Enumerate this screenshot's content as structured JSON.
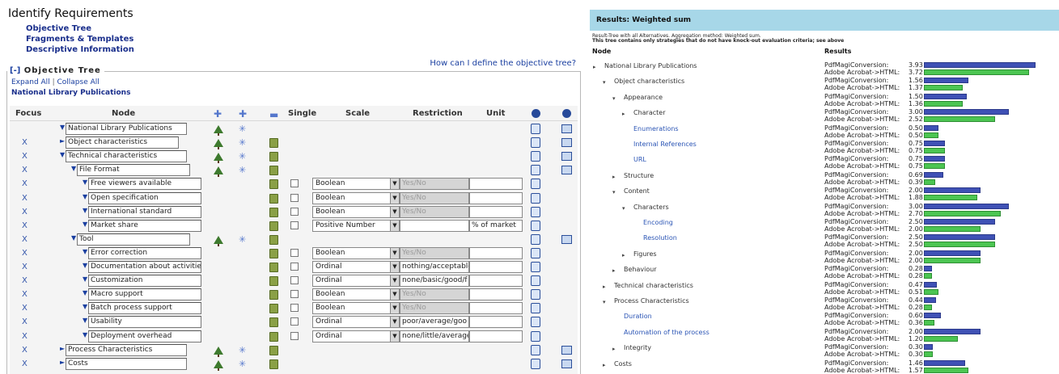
{
  "left": {
    "title": "Identify Requirements",
    "nav": [
      "Objective Tree",
      "Fragments & Templates",
      "Descriptive Information"
    ],
    "help_link": "How can I define the objective tree?",
    "legend_toggle": "[-]",
    "legend_title": "Objective Tree",
    "expand_all": "Expand All",
    "separator": "|",
    "collapse_all": "Collapse All",
    "breadcrumb": "National Library Publications",
    "headers": {
      "focus": "Focus",
      "node": "Node",
      "single": "Single",
      "scale": "Scale",
      "restriction": "Restriction",
      "unit": "Unit"
    },
    "rows": [
      {
        "x": "",
        "tri": "▼",
        "label": "National Library Publications",
        "indent": 62,
        "w": 150,
        "tree": true,
        "snow": true,
        "trash": false,
        "leaf": false,
        "i2": true
      },
      {
        "x": "X",
        "tri": "►",
        "label": "Object characteristics",
        "indent": 62,
        "w": 140,
        "tree": true,
        "snow": true,
        "trash": true,
        "leaf": false,
        "i2": true
      },
      {
        "x": "X",
        "tri": "▼",
        "label": "Technical characteristics",
        "indent": 62,
        "w": 150,
        "tree": true,
        "snow": true,
        "trash": true,
        "leaf": false,
        "i2": true
      },
      {
        "x": "X",
        "tri": "▼",
        "label": "File Format",
        "indent": 76,
        "w": 140,
        "tree": true,
        "snow": true,
        "trash": true,
        "leaf": false,
        "i2": true
      },
      {
        "x": "X",
        "tri": "▼",
        "label": "Free viewers available",
        "indent": 90,
        "w": 140,
        "trash": true,
        "leaf": true,
        "scale": "Boolean",
        "restriction": "Yes/No",
        "dis": true,
        "unit": ""
      },
      {
        "x": "X",
        "tri": "▼",
        "label": "Open specification",
        "indent": 90,
        "w": 140,
        "trash": true,
        "leaf": true,
        "scale": "Boolean",
        "restriction": "Yes/No",
        "dis": true,
        "unit": ""
      },
      {
        "x": "X",
        "tri": "▼",
        "label": "International standard",
        "indent": 90,
        "w": 140,
        "trash": true,
        "leaf": true,
        "scale": "Boolean",
        "restriction": "Yes/No",
        "dis": true,
        "unit": ""
      },
      {
        "x": "X",
        "tri": "▼",
        "label": "Market share",
        "indent": 90,
        "w": 140,
        "trash": true,
        "leaf": true,
        "scale": "Positive Number",
        "restriction": "",
        "dis": false,
        "unit": "% of market"
      },
      {
        "x": "X",
        "tri": "▼",
        "label": "Tool",
        "indent": 76,
        "w": 140,
        "tree": true,
        "snow": true,
        "trash": true,
        "leaf": false,
        "i2": true
      },
      {
        "x": "X",
        "tri": "▼",
        "label": "Error correction",
        "indent": 90,
        "w": 140,
        "trash": true,
        "leaf": true,
        "scale": "Boolean",
        "restriction": "Yes/No",
        "dis": true,
        "unit": ""
      },
      {
        "x": "X",
        "tri": "▼",
        "label": "Documentation about activities",
        "indent": 90,
        "w": 140,
        "trash": true,
        "leaf": true,
        "scale": "Ordinal",
        "restriction": "nothing/acceptable",
        "dis": false,
        "unit": ""
      },
      {
        "x": "X",
        "tri": "▼",
        "label": "Customization",
        "indent": 90,
        "w": 140,
        "trash": true,
        "leaf": true,
        "scale": "Ordinal",
        "restriction": "none/basic/good/f",
        "dis": false,
        "unit": ""
      },
      {
        "x": "X",
        "tri": "▼",
        "label": "Macro support",
        "indent": 90,
        "w": 140,
        "trash": true,
        "leaf": true,
        "scale": "Boolean",
        "restriction": "Yes/No",
        "dis": true,
        "unit": ""
      },
      {
        "x": "X",
        "tri": "▼",
        "label": "Batch process support",
        "indent": 90,
        "w": 140,
        "trash": true,
        "leaf": true,
        "scale": "Boolean",
        "restriction": "Yes/No",
        "dis": true,
        "unit": ""
      },
      {
        "x": "X",
        "tri": "▼",
        "label": "Usability",
        "indent": 90,
        "w": 140,
        "trash": true,
        "leaf": true,
        "scale": "Ordinal",
        "restriction": "poor/average/goo",
        "dis": false,
        "unit": ""
      },
      {
        "x": "X",
        "tri": "▼",
        "label": "Deployment overhead",
        "indent": 90,
        "w": 140,
        "trash": true,
        "leaf": true,
        "scale": "Ordinal",
        "restriction": "none/little/average",
        "dis": false,
        "unit": ""
      },
      {
        "x": "X",
        "tri": "►",
        "label": "Process Characteristics",
        "indent": 62,
        "w": 150,
        "tree": true,
        "snow": true,
        "trash": true,
        "leaf": false,
        "i2": true
      },
      {
        "x": "X",
        "tri": "►",
        "label": "Costs",
        "indent": 62,
        "w": 150,
        "tree": true,
        "snow": true,
        "trash": true,
        "leaf": false,
        "i2": true
      }
    ]
  },
  "right": {
    "header": "Results: Weighted sum",
    "info1": "Result-Tree with all Alternatives. Aggregation method: Weighted sum.",
    "info2": "This tree contains only strategies that do not have knock-out evaluation criteria; see above",
    "col_node": "Node",
    "col_results": "Results",
    "alt1": "PdfMagiConversion:",
    "alt2": "Adobe Acrobat->HTML:",
    "bar_max": 4,
    "color_alt1": "#3f51b5",
    "color_alt2": "#4cc552",
    "rows": [
      {
        "bul": "▸",
        "label": "National Library Publications",
        "indent": 4,
        "link": false,
        "v1": "3.93",
        "v2": "3.72"
      },
      {
        "bul": "▾",
        "label": "Object characteristics",
        "indent": 16,
        "link": false,
        "v1": "1.56",
        "v2": "1.37"
      },
      {
        "bul": "▾",
        "label": "Appearance",
        "indent": 28,
        "link": false,
        "v1": "1.50",
        "v2": "1.36"
      },
      {
        "bul": "▸",
        "label": "Character",
        "indent": 40,
        "link": false,
        "v1": "3.00",
        "v2": "2.52"
      },
      {
        "bul": "",
        "label": "Enumerations",
        "indent": 40,
        "link": true,
        "v1": "0.50",
        "v2": "0.50"
      },
      {
        "bul": "",
        "label": "Internal References",
        "indent": 40,
        "link": true,
        "v1": "0.75",
        "v2": "0.75"
      },
      {
        "bul": "",
        "label": "URL",
        "indent": 40,
        "link": true,
        "v1": "0.75",
        "v2": "0.75"
      },
      {
        "bul": "▸",
        "label": "Structure",
        "indent": 28,
        "link": false,
        "v1": "0.69",
        "v2": "0.39"
      },
      {
        "bul": "▾",
        "label": "Content",
        "indent": 28,
        "link": false,
        "v1": "2.00",
        "v2": "1.88"
      },
      {
        "bul": "▾",
        "label": "Characters",
        "indent": 40,
        "link": false,
        "v1": "3.00",
        "v2": "2.70"
      },
      {
        "bul": "",
        "label": "Encoding",
        "indent": 52,
        "link": true,
        "v1": "2.50",
        "v2": "2.00"
      },
      {
        "bul": "",
        "label": "Resolution",
        "indent": 52,
        "link": true,
        "v1": "2.50",
        "v2": "2.50"
      },
      {
        "bul": "▸",
        "label": "Figures",
        "indent": 40,
        "link": false,
        "v1": "2.00",
        "v2": "2.00"
      },
      {
        "bul": "▸",
        "label": "Behaviour",
        "indent": 28,
        "link": false,
        "v1": "0.28",
        "v2": "0.28"
      },
      {
        "bul": "▸",
        "label": "Technical characteristics",
        "indent": 16,
        "link": false,
        "v1": "0.47",
        "v2": "0.51"
      },
      {
        "bul": "▾",
        "label": "Process Characteristics",
        "indent": 16,
        "link": false,
        "v1": "0.44",
        "v2": "0.28"
      },
      {
        "bul": "",
        "label": "Duration",
        "indent": 28,
        "link": true,
        "v1": "0.60",
        "v2": "0.36"
      },
      {
        "bul": "",
        "label": "Automation of the process",
        "indent": 28,
        "link": true,
        "v1": "2.00",
        "v2": "1.20"
      },
      {
        "bul": "▸",
        "label": "Integrity",
        "indent": 28,
        "link": false,
        "v1": "0.30",
        "v2": "0.30"
      },
      {
        "bul": "▸",
        "label": "Costs",
        "indent": 16,
        "link": false,
        "v1": "1.46",
        "v2": "1.57"
      }
    ]
  }
}
